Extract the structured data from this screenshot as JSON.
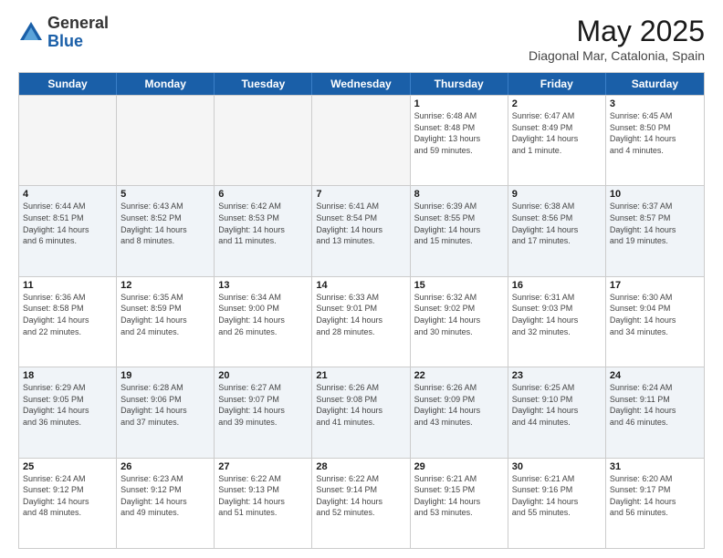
{
  "logo": {
    "general": "General",
    "blue": "Blue"
  },
  "header": {
    "month": "May 2025",
    "location": "Diagonal Mar, Catalonia, Spain"
  },
  "weekdays": [
    "Sunday",
    "Monday",
    "Tuesday",
    "Wednesday",
    "Thursday",
    "Friday",
    "Saturday"
  ],
  "weeks": [
    [
      {
        "day": "",
        "info": "",
        "empty": true
      },
      {
        "day": "",
        "info": "",
        "empty": true
      },
      {
        "day": "",
        "info": "",
        "empty": true
      },
      {
        "day": "",
        "info": "",
        "empty": true
      },
      {
        "day": "1",
        "info": "Sunrise: 6:48 AM\nSunset: 8:48 PM\nDaylight: 13 hours\nand 59 minutes.",
        "empty": false
      },
      {
        "day": "2",
        "info": "Sunrise: 6:47 AM\nSunset: 8:49 PM\nDaylight: 14 hours\nand 1 minute.",
        "empty": false
      },
      {
        "day": "3",
        "info": "Sunrise: 6:45 AM\nSunset: 8:50 PM\nDaylight: 14 hours\nand 4 minutes.",
        "empty": false
      }
    ],
    [
      {
        "day": "4",
        "info": "Sunrise: 6:44 AM\nSunset: 8:51 PM\nDaylight: 14 hours\nand 6 minutes.",
        "empty": false
      },
      {
        "day": "5",
        "info": "Sunrise: 6:43 AM\nSunset: 8:52 PM\nDaylight: 14 hours\nand 8 minutes.",
        "empty": false
      },
      {
        "day": "6",
        "info": "Sunrise: 6:42 AM\nSunset: 8:53 PM\nDaylight: 14 hours\nand 11 minutes.",
        "empty": false
      },
      {
        "day": "7",
        "info": "Sunrise: 6:41 AM\nSunset: 8:54 PM\nDaylight: 14 hours\nand 13 minutes.",
        "empty": false
      },
      {
        "day": "8",
        "info": "Sunrise: 6:39 AM\nSunset: 8:55 PM\nDaylight: 14 hours\nand 15 minutes.",
        "empty": false
      },
      {
        "day": "9",
        "info": "Sunrise: 6:38 AM\nSunset: 8:56 PM\nDaylight: 14 hours\nand 17 minutes.",
        "empty": false
      },
      {
        "day": "10",
        "info": "Sunrise: 6:37 AM\nSunset: 8:57 PM\nDaylight: 14 hours\nand 19 minutes.",
        "empty": false
      }
    ],
    [
      {
        "day": "11",
        "info": "Sunrise: 6:36 AM\nSunset: 8:58 PM\nDaylight: 14 hours\nand 22 minutes.",
        "empty": false
      },
      {
        "day": "12",
        "info": "Sunrise: 6:35 AM\nSunset: 8:59 PM\nDaylight: 14 hours\nand 24 minutes.",
        "empty": false
      },
      {
        "day": "13",
        "info": "Sunrise: 6:34 AM\nSunset: 9:00 PM\nDaylight: 14 hours\nand 26 minutes.",
        "empty": false
      },
      {
        "day": "14",
        "info": "Sunrise: 6:33 AM\nSunset: 9:01 PM\nDaylight: 14 hours\nand 28 minutes.",
        "empty": false
      },
      {
        "day": "15",
        "info": "Sunrise: 6:32 AM\nSunset: 9:02 PM\nDaylight: 14 hours\nand 30 minutes.",
        "empty": false
      },
      {
        "day": "16",
        "info": "Sunrise: 6:31 AM\nSunset: 9:03 PM\nDaylight: 14 hours\nand 32 minutes.",
        "empty": false
      },
      {
        "day": "17",
        "info": "Sunrise: 6:30 AM\nSunset: 9:04 PM\nDaylight: 14 hours\nand 34 minutes.",
        "empty": false
      }
    ],
    [
      {
        "day": "18",
        "info": "Sunrise: 6:29 AM\nSunset: 9:05 PM\nDaylight: 14 hours\nand 36 minutes.",
        "empty": false
      },
      {
        "day": "19",
        "info": "Sunrise: 6:28 AM\nSunset: 9:06 PM\nDaylight: 14 hours\nand 37 minutes.",
        "empty": false
      },
      {
        "day": "20",
        "info": "Sunrise: 6:27 AM\nSunset: 9:07 PM\nDaylight: 14 hours\nand 39 minutes.",
        "empty": false
      },
      {
        "day": "21",
        "info": "Sunrise: 6:26 AM\nSunset: 9:08 PM\nDaylight: 14 hours\nand 41 minutes.",
        "empty": false
      },
      {
        "day": "22",
        "info": "Sunrise: 6:26 AM\nSunset: 9:09 PM\nDaylight: 14 hours\nand 43 minutes.",
        "empty": false
      },
      {
        "day": "23",
        "info": "Sunrise: 6:25 AM\nSunset: 9:10 PM\nDaylight: 14 hours\nand 44 minutes.",
        "empty": false
      },
      {
        "day": "24",
        "info": "Sunrise: 6:24 AM\nSunset: 9:11 PM\nDaylight: 14 hours\nand 46 minutes.",
        "empty": false
      }
    ],
    [
      {
        "day": "25",
        "info": "Sunrise: 6:24 AM\nSunset: 9:12 PM\nDaylight: 14 hours\nand 48 minutes.",
        "empty": false
      },
      {
        "day": "26",
        "info": "Sunrise: 6:23 AM\nSunset: 9:12 PM\nDaylight: 14 hours\nand 49 minutes.",
        "empty": false
      },
      {
        "day": "27",
        "info": "Sunrise: 6:22 AM\nSunset: 9:13 PM\nDaylight: 14 hours\nand 51 minutes.",
        "empty": false
      },
      {
        "day": "28",
        "info": "Sunrise: 6:22 AM\nSunset: 9:14 PM\nDaylight: 14 hours\nand 52 minutes.",
        "empty": false
      },
      {
        "day": "29",
        "info": "Sunrise: 6:21 AM\nSunset: 9:15 PM\nDaylight: 14 hours\nand 53 minutes.",
        "empty": false
      },
      {
        "day": "30",
        "info": "Sunrise: 6:21 AM\nSunset: 9:16 PM\nDaylight: 14 hours\nand 55 minutes.",
        "empty": false
      },
      {
        "day": "31",
        "info": "Sunrise: 6:20 AM\nSunset: 9:17 PM\nDaylight: 14 hours\nand 56 minutes.",
        "empty": false
      }
    ]
  ]
}
